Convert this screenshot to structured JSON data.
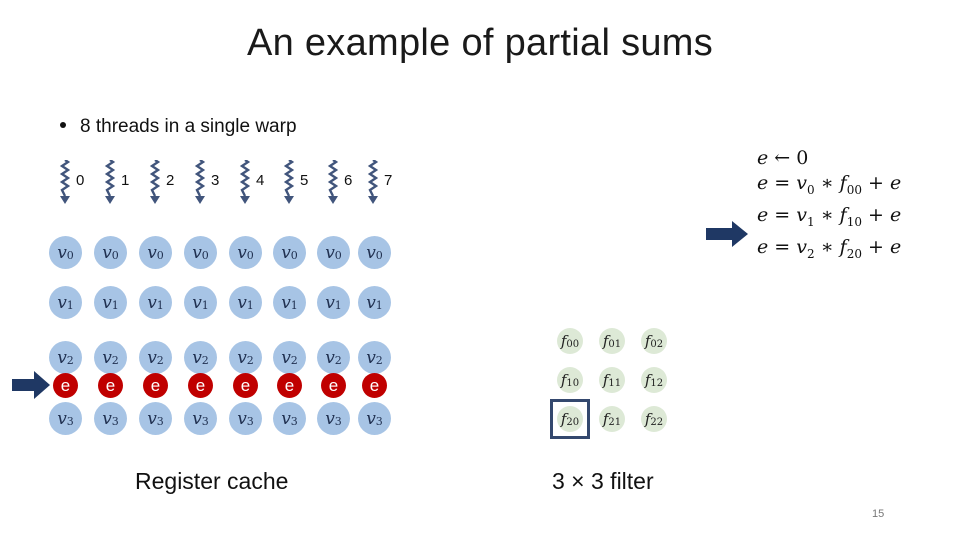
{
  "slide": {
    "title": "An example of partial sums",
    "bullet": "8 threads in a single warp",
    "page_number": "15"
  },
  "threads": {
    "labels": [
      "0",
      "1",
      "2",
      "3",
      "4",
      "5",
      "6",
      "7"
    ],
    "icon": "wavy-arrow-down-icon"
  },
  "register_cache": {
    "caption": "Register cache",
    "rows": [
      {
        "var": "v",
        "sub": "0"
      },
      {
        "var": "v",
        "sub": "1"
      },
      {
        "var": "v",
        "sub": "2"
      },
      {
        "var": "v",
        "sub": "3"
      }
    ],
    "accumulator_label": "e",
    "active_row_arrow": "arrow-right-icon"
  },
  "filter": {
    "caption": "3 × 3 filter",
    "cells": [
      [
        "00",
        "01",
        "02"
      ],
      [
        "10",
        "11",
        "12"
      ],
      [
        "20",
        "21",
        "22"
      ]
    ],
    "highlighted_cell": "20"
  },
  "equations": [
    {
      "lhs": "e",
      "op": "←",
      "rhs": "0"
    },
    {
      "lhs": "e",
      "op": "=",
      "v": "0",
      "f": "00"
    },
    {
      "lhs": "e",
      "op": "=",
      "v": "1",
      "f": "10"
    },
    {
      "lhs": "e",
      "op": "=",
      "v": "2",
      "f": "20"
    }
  ],
  "current_equation_index": 3,
  "colors": {
    "register_circle": "#a7c4e5",
    "accumulator_circle": "#c00000",
    "filter_circle": "#dde9d6",
    "arrow": "#1f3864",
    "highlight_box": "#34486e"
  }
}
